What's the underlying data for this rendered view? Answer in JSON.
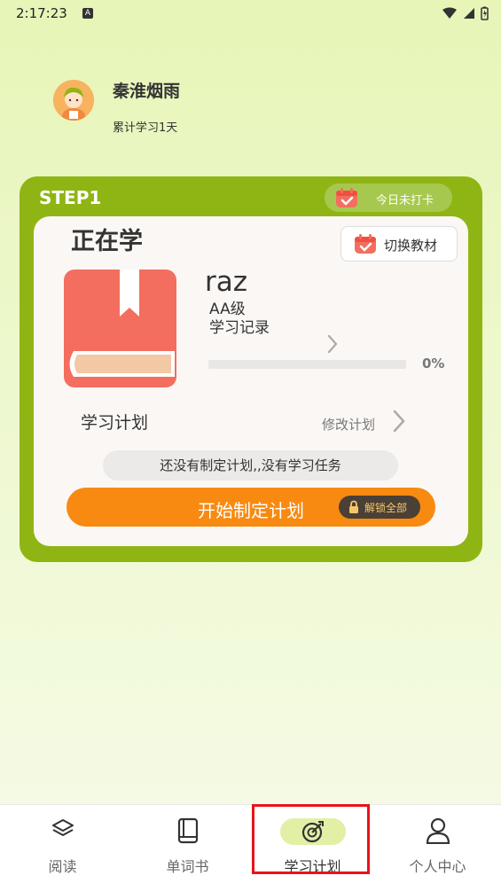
{
  "status_bar": {
    "time": "2:17:23",
    "notification_badge": "A"
  },
  "profile": {
    "username": "秦淮烟雨",
    "study_stat": "累计学习1天"
  },
  "card": {
    "step_label": "STEP1",
    "checkin_status": "今日未打卡",
    "current_title": "正在学",
    "switch_button": "切换教材",
    "book": {
      "name": "raz",
      "level": "AA级",
      "record_link": "学习记录",
      "progress_percent": 0,
      "progress_label": "0%"
    },
    "plan": {
      "label": "学习计划",
      "modify_link": "修改计划",
      "empty_message": "还没有制定计划,,没有学习任务",
      "start_button": "开始制定计划",
      "unlock_badge": "解锁全部"
    }
  },
  "tabs": [
    {
      "label": "阅读",
      "icon": "layers-icon",
      "active": false
    },
    {
      "label": "单词书",
      "icon": "book-icon",
      "active": false
    },
    {
      "label": "学习计划",
      "icon": "target-icon",
      "active": true
    },
    {
      "label": "个人中心",
      "icon": "person-icon",
      "active": false
    }
  ],
  "colors": {
    "card_green": "#8fb514",
    "start_orange": "#f88a11",
    "book_red": "#f36e5e",
    "highlight_red": "#e8131b"
  }
}
